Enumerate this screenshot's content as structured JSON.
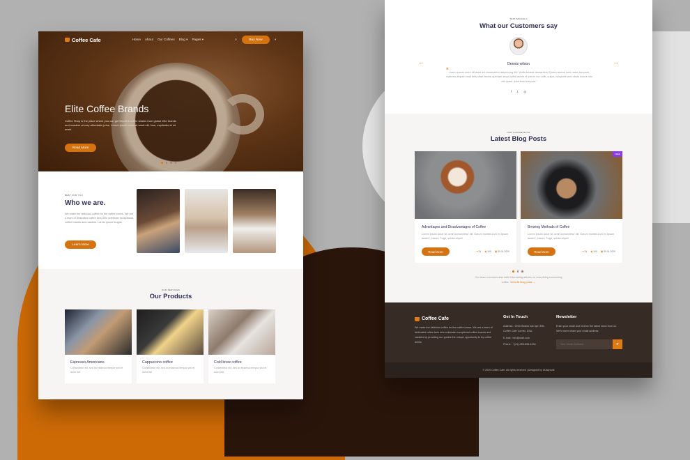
{
  "colors": {
    "accent": "#d4730f",
    "heading": "#2f2e55",
    "badge": "#8b3af2",
    "footer": "#372b26"
  },
  "home": {
    "nav": {
      "logo": "Coffee Cafe",
      "items": [
        "Home",
        "About",
        "Our Coffees",
        "Blog ▾",
        "Pages ▾"
      ],
      "buy": "Buy Now",
      "search_icon": "⌕",
      "theme_icon": "◐"
    },
    "hero": {
      "title": "Elite Coffee Brands",
      "text": "Coffee Shop is the place where you can get flavorful coffee strains from global elite brands and roasters at very affordable price. Lorem ipsum dolor sit amet elit. Non, explicabo et sit amet.",
      "button": "Read More",
      "slides": 4,
      "active_slide": 1
    },
    "about": {
      "eyebrow": "BEST FOR YOU",
      "title": "Who we are.",
      "text": "We make the delicious coffee for the coffee lovers. We are a team of dedicated coffee fans who celebrate exceptional coffee brands and roasters. Lorem ipsum feugiat.",
      "button": "Learn More"
    },
    "products": {
      "eyebrow": "OUR SERVICES",
      "title": "Our Products",
      "items": [
        {
          "title": "Espresso Americano",
          "desc": "Consectetur elit, sed do eiusmod tempor sed et dolor licit"
        },
        {
          "title": "Cappuccino coffee",
          "desc": "Consectetur elit, sed do eiusmod tempor sed et dolor licit"
        },
        {
          "title": "Cold brew coffee",
          "desc": "Consectetur elit, sed do eiusmod tempor sed et dolor licit"
        }
      ]
    }
  },
  "second": {
    "testimonials": {
      "eyebrow": "TESTIMONIALS",
      "title": "What our Customers say",
      "name": "Dennis wilson",
      "quote": "Lorem ipsum dolor sit amet int consectetur adipisicing elit. Velita beatae laudantium Quas minima sunt natus tempore, maiores aliquid modi felis vitae facere aperiam sequi optio lacinia id ipsum non velit, culpa, voluptate rem ullam dolore nisi est quasi, doloribus tempora.\"",
      "prev": "←",
      "next": "→",
      "social": [
        "f",
        "t",
        "◎"
      ]
    },
    "blog": {
      "eyebrow": "OUR COFFEE BLOG",
      "title": "Latest Blog Posts",
      "posts": [
        {
          "title": "Advantages and Disadvantages of Coffee",
          "desc": "Lorem ipsum dolor sit, amet consectetur elit. Earum mollitia cum ex ipsam autem!, earum. Fuga, soluta atque!",
          "button": "Read more",
          "likes": "24",
          "views": "105",
          "date": "30.01.2020"
        },
        {
          "title": "Brewing Methods of Coffee",
          "desc": "Lorem ipsum dolor sit, amet consectetur elit. Earum mollitia cum ex ipsam autem!, earum. Fuga, soluta atque!",
          "button": "Read more",
          "likes": "24",
          "views": "105",
          "date": "30.01.2020",
          "badge": "FREE"
        }
      ],
      "footer_text": "Our team members also write interesting articles on everything concerning coffee.",
      "link": "View All blog posts →"
    },
    "footer": {
      "logo": "Coffee Cafe",
      "about": "We make the delicious coffee for the coffee lovers. We are a team of dedicated coffee fans who celebrate exceptional coffee brands and roasters by providing our guests the unique opportunity to try coffee drinks",
      "contact_title": "Get In Touch",
      "address": "Address : 2003 Stokes Isle Apt. 895, Coffee Cafe Corner, USA.",
      "email": "E-mail : info@mail.com",
      "phone": "Phone : +(21)-255-896-1234",
      "newsletter_title": "Newsletter",
      "newsletter_text": "Enter your email and receive the latest news from us. We'll never share your email address",
      "email_placeholder": "Your Email Address",
      "send_icon": "➤",
      "copyright": "© 2020 Coffee Cafe. All rights reserved | Designed by W3layouts"
    }
  }
}
